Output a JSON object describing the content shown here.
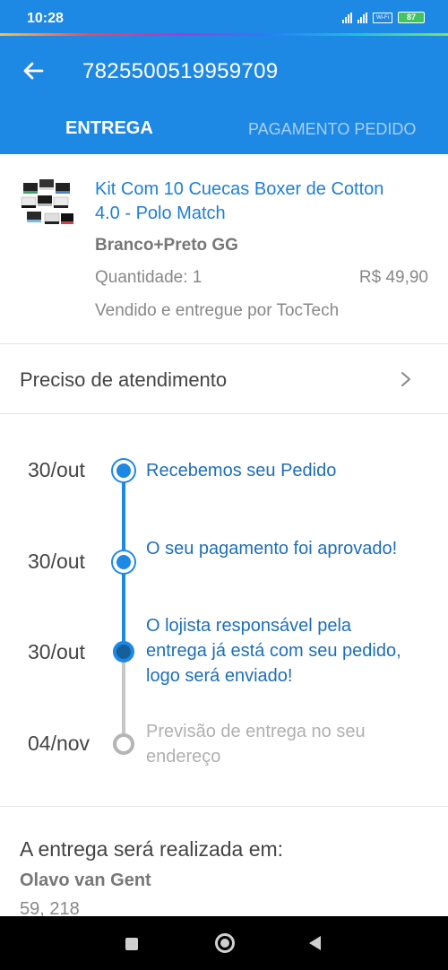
{
  "status_bar": {
    "time": "10:28",
    "wifi_label": "Wi-Fi",
    "battery": "87"
  },
  "header": {
    "order_number": "7825500519959709",
    "back_icon": "arrow-left-icon",
    "tabs": [
      {
        "label": "ENTREGA",
        "active": true
      },
      {
        "label": "PAGAMENTO PEDIDO",
        "active": false
      }
    ]
  },
  "product": {
    "title": "Kit Com 10 Cuecas Boxer de Cotton 4.0 - Polo Match",
    "variant": "Branco+Preto GG",
    "quantity": "Quantidade: 1",
    "price": "R$ 49,90",
    "seller": "Vendido e entregue por TocTech"
  },
  "support": {
    "label": "Preciso de atendimento",
    "icon": "chevron-right-icon"
  },
  "timeline": [
    {
      "date": "30/out",
      "text": "Recebemos seu Pedido",
      "status": "done"
    },
    {
      "date": "30/out",
      "text": "O seu pagamento foi aprovado!",
      "status": "done"
    },
    {
      "date": "30/out",
      "text": "O lojista responsável pela entrega já está com seu pedido, logo será enviado!",
      "status": "current"
    },
    {
      "date": "04/nov",
      "text": "Previsão de entrega no seu endereço",
      "status": "pending"
    }
  ],
  "delivery": {
    "title": "A entrega será realizada em:",
    "recipient": "Olavo van Gent",
    "address": "59, 218"
  },
  "colors": {
    "primary": "#1e88e5",
    "link_text": "#1c6fba",
    "muted": "#b0b0b0"
  }
}
